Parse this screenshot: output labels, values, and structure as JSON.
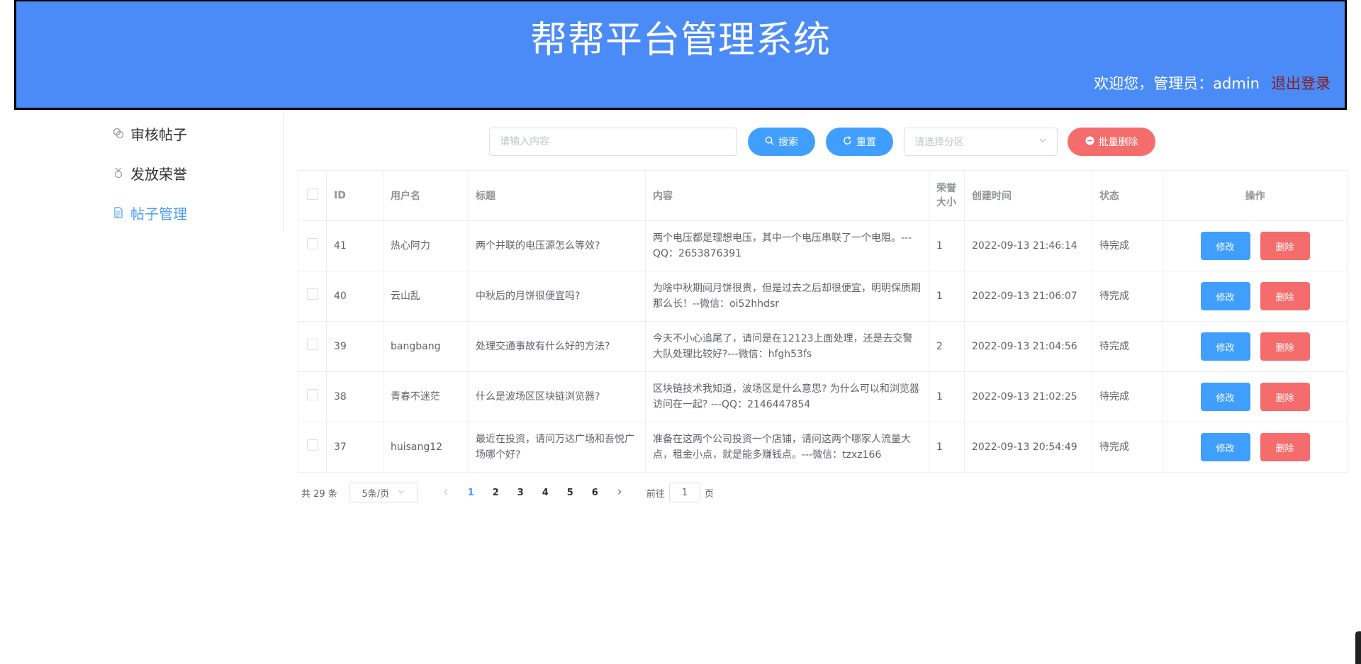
{
  "header": {
    "title": "帮帮平台管理系统",
    "welcome": "欢迎您，管理员：admin",
    "logout": "退出登录"
  },
  "sidebar": {
    "items": [
      {
        "label": "审核帖子",
        "icon": "chat-icon"
      },
      {
        "label": "发放荣誉",
        "icon": "medal-icon"
      },
      {
        "label": "帖子管理",
        "icon": "document-icon",
        "active": true
      }
    ]
  },
  "toolbar": {
    "search_placeholder": "请输入内容",
    "search_label": "搜索",
    "reset_label": "重置",
    "select_placeholder": "请选择分区",
    "batch_delete_label": "批量删除"
  },
  "table": {
    "headers": {
      "id": "ID",
      "username": "用户名",
      "title": "标题",
      "content": "内容",
      "honor": "荣誉大小",
      "created": "创建时间",
      "status": "状态",
      "actions": "操作"
    },
    "edit_label": "修改",
    "delete_label": "删除",
    "rows": [
      {
        "id": "41",
        "username": "热心阿力",
        "title": "两个并联的电压源怎么等效?",
        "content": "两个电压都是理想电压，其中一个电压串联了一个电阻。---QQ：2653876391",
        "honor": "1",
        "created": "2022-09-13 21:46:14",
        "status": "待完成"
      },
      {
        "id": "40",
        "username": "云山乱",
        "title": "中秋后的月饼很便宜吗?",
        "content": "为啥中秋期间月饼很贵，但是过去之后却很便宜，明明保质期那么长！--微信：oi52hhdsr",
        "honor": "1",
        "created": "2022-09-13 21:06:07",
        "status": "待完成"
      },
      {
        "id": "39",
        "username": "bangbang",
        "title": "处理交通事故有什么好的方法?",
        "content": "今天不小心追尾了，请问是在12123上面处理，还是去交警大队处理比较好?---微信：hfgh53fs",
        "honor": "2",
        "created": "2022-09-13 21:04:56",
        "status": "待完成"
      },
      {
        "id": "38",
        "username": "青春不迷茫",
        "title": "什么是波场区区块链浏览器?",
        "content": "区块链技术我知道，波场区是什么意思? 为什么可以和浏览器访问在一起? ---QQ：2146447854",
        "honor": "1",
        "created": "2022-09-13 21:02:25",
        "status": "待完成"
      },
      {
        "id": "37",
        "username": "huisang12",
        "title": "最近在投资，请问万达广场和吾悦广场哪个好?",
        "content": "准备在这两个公司投资一个店铺，请问这两个哪家人流量大点，租金小点，就是能多赚钱点。---微信：tzxz166",
        "honor": "1",
        "created": "2022-09-13 20:54:49",
        "status": "待完成"
      }
    ]
  },
  "pagination": {
    "total": "共 29 条",
    "page_size": "5条/页",
    "pages": [
      "1",
      "2",
      "3",
      "4",
      "5",
      "6"
    ],
    "current": "1",
    "goto_prefix": "前往",
    "goto_value": "1",
    "goto_suffix": "页"
  },
  "colors": {
    "header_bg": "#4b8bf7",
    "primary": "#409eff",
    "danger": "#f56c6c",
    "logout": "#8a1b1b"
  }
}
